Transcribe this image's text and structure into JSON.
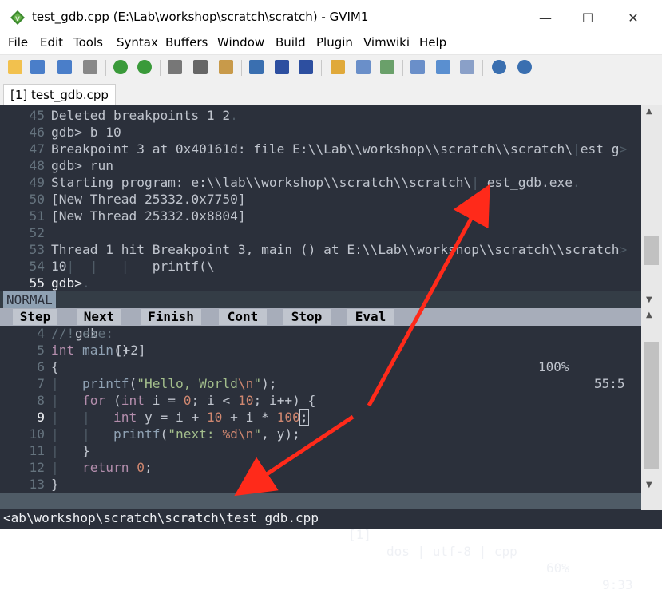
{
  "window": {
    "title": "test_gdb.cpp (E:\\Lab\\workshop\\scratch\\scratch) - GVIM1",
    "minimize": "—",
    "maximize": "☐",
    "close": "✕"
  },
  "menu": [
    "File",
    "Edit",
    "Tools",
    "Syntax",
    "Buffers",
    "Window",
    "Build",
    "Plugin",
    "Vimwiki",
    "Help"
  ],
  "toolbar_icons": [
    "open-icon",
    "save-icon",
    "save-all-icon",
    "print-icon",
    "undo-icon",
    "redo-icon",
    "cut-icon",
    "copy-icon",
    "paste-icon",
    "find-replace-icon",
    "find-next-icon",
    "find-prev-icon",
    "load-session-icon",
    "save-session-icon",
    "run-script-icon",
    "make-icon",
    "build-tags-icon",
    "jump-tag-icon",
    "help-icon",
    "find-help-icon"
  ],
  "tab": "[1] test_gdb.cpp",
  "gdb_lines": [
    {
      "n": "45",
      "t": "Deleted breakpoints 1 2"
    },
    {
      "n": "46",
      "t": "gdb> b 10"
    },
    {
      "n": "47",
      "t": "Breakpoint 3 at 0x40161d: file E:\\\\Lab\\\\workshop\\\\scratch\\\\scratch\\"
    },
    {
      "n": "48",
      "t": "gdb> run"
    },
    {
      "n": "49",
      "t": "Starting program: e:\\\\lab\\\\workshop\\\\scratch\\\\scratch\\"
    },
    {
      "n": "50",
      "t": "[New Thread 25332.0x7750]"
    },
    {
      "n": "51",
      "t": "[New Thread 25332.0x8804]"
    },
    {
      "n": "52",
      "t": ""
    },
    {
      "n": "53",
      "t": "Thread 1 hit Breakpoint 3, main () at E:\\\\Lab\\\\workshop\\\\scratch\\\\scratch"
    },
    {
      "n": "54",
      "t": "10"
    },
    {
      "n": "55",
      "t": "gdb>"
    }
  ],
  "gdb_line47_tail": "est_g",
  "gdb_line49_tail": "est_gdb.exe",
  "gdb_line54_code": "printf(\\",
  "gdb_status": {
    "mode": "NORMAL",
    "name": "gdb",
    "modified": "[+2]",
    "percent": "100%",
    "pos": "55:5"
  },
  "gdb_buttons": [
    "Step",
    "Next",
    "Finish",
    "Cont",
    "Stop",
    "Eval"
  ],
  "code_lines": [
    {
      "n": "4"
    },
    {
      "n": "5"
    },
    {
      "n": "6"
    },
    {
      "n": "7"
    },
    {
      "n": "8"
    },
    {
      "n": "9"
    },
    {
      "n": "10"
    },
    {
      "n": "11"
    },
    {
      "n": "12"
    },
    {
      "n": "13"
    }
  ],
  "code": {
    "l4": "//! exe:",
    "l5_kw": "int",
    "l5_fn": "main",
    "l5_rest": "()",
    "l6": "{",
    "l7_fn": "printf",
    "l7_a": "(",
    "l7_str": "\"Hello, World",
    "l7_esc": "\\n",
    "l7_str2": "\"",
    "l7_end": ");",
    "l8_kw": "for",
    "l8_a": " (",
    "l8_kw2": "int",
    "l8_b": " i = ",
    "l8_n0": "0",
    "l8_c": "; i < ",
    "l8_n10": "10",
    "l8_d": "; i++) {",
    "l9_kw": "int",
    "l9_a": " y = i + ",
    "l9_n10": "10",
    "l9_b": " + i * ",
    "l9_n100": "100",
    "l9_cur": ";",
    "l10_fn": "printf",
    "l10_a": "(",
    "l10_str": "\"next: ",
    "l10_fmt": "%d\\n",
    "l10_str2": "\"",
    "l10_end": ", y);",
    "l11": "}",
    "l12_kw": "return",
    "l12_n": "0",
    "l12_end": ";",
    "l13": "}"
  },
  "file_status": {
    "path": "<ab\\workshop\\scratch\\scratch\\test_gdb.cpp",
    "buf": "[1]",
    "ff": "dos | utf-8 | cpp",
    "percent": "60%",
    "pos": "9:33"
  },
  "colors": {
    "bg": "#2b303b",
    "fg": "#c0c5ce",
    "annotation_arrow": "#ff2a1a"
  }
}
